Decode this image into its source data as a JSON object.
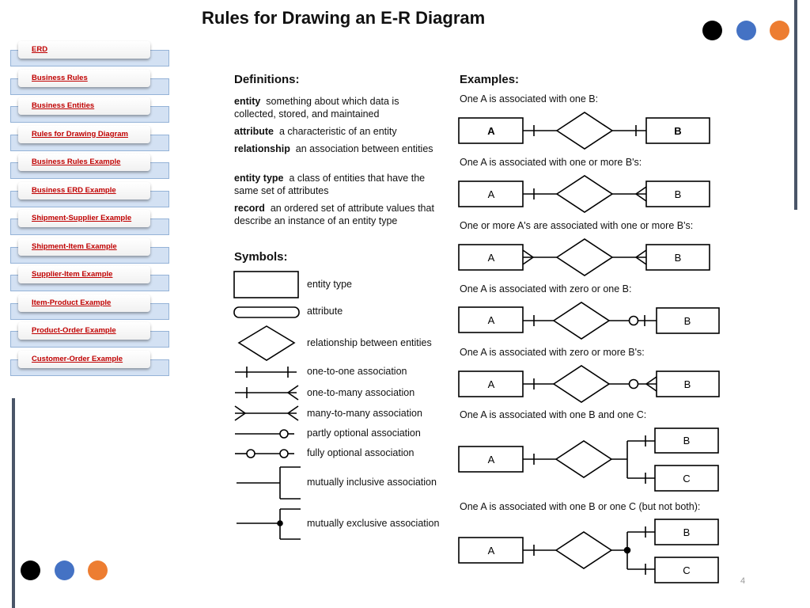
{
  "title": "Rules for Drawing an E-R Diagram",
  "page_number": "4",
  "colors": {
    "dot_black": "#000000",
    "dot_blue": "#4472c4",
    "dot_orange": "#ed7d31",
    "nav_link": "#c00000",
    "nav_back": "#d3e1f3",
    "accent_bar": "#4a5568"
  },
  "nav": {
    "items": [
      {
        "label": "ERD"
      },
      {
        "label": "Business Rules"
      },
      {
        "label": "Business Entities"
      },
      {
        "label": "Rules for Drawing Diagram"
      },
      {
        "label": "Business Rules Example"
      },
      {
        "label": "Business ERD Example"
      },
      {
        "label": "Shipment-Supplier Example"
      },
      {
        "label": "Shipment-Item Example"
      },
      {
        "label": "Supplier-Item Example"
      },
      {
        "label": "Item-Product Example"
      },
      {
        "label": "Product-Order Example"
      },
      {
        "label": "Customer-Order Example"
      }
    ]
  },
  "definitions": {
    "heading": "Definitions:",
    "items": [
      {
        "term": "entity",
        "text": "something about which data is collected, stored, and maintained"
      },
      {
        "term": "attribute",
        "text": "a characteristic of an entity"
      },
      {
        "term": "relationship",
        "text": "an association between entities"
      },
      {
        "term": "entity type",
        "text": "a class of entities that have the same set of attributes"
      },
      {
        "term": "record",
        "text": "an ordered set of attribute values that describe an instance of an entity type"
      }
    ]
  },
  "symbols": {
    "heading": "Symbols:",
    "items": [
      {
        "icon": "entity-type-rectangle",
        "label": "entity type"
      },
      {
        "icon": "attribute-rounded-rectangle",
        "label": "attribute"
      },
      {
        "icon": "relationship-diamond",
        "label": "relationship between entities"
      },
      {
        "icon": "one-to-one-line",
        "label": "one-to-one association"
      },
      {
        "icon": "one-to-many-line",
        "label": "one-to-many association"
      },
      {
        "icon": "many-to-many-line",
        "label": "many-to-many association"
      },
      {
        "icon": "partly-optional-line",
        "label": "partly optional association"
      },
      {
        "icon": "fully-optional-line",
        "label": "fully optional association"
      },
      {
        "icon": "mutually-inclusive-bracket",
        "label": "mutually inclusive association"
      },
      {
        "icon": "mutually-exclusive-bracket",
        "label": "mutually exclusive association"
      }
    ]
  },
  "examples": {
    "heading": "Examples:",
    "items": [
      {
        "caption": "One A is associated with one B:",
        "left": "A",
        "right": [
          "B"
        ]
      },
      {
        "caption": "One A is associated with one or more B's:",
        "left": "A",
        "right": [
          "B"
        ]
      },
      {
        "caption": "One or more A's are associated with one or more B's:",
        "left": "A",
        "right": [
          "B"
        ]
      },
      {
        "caption": "One A is associated with zero or one B:",
        "left": "A",
        "right": [
          "B"
        ]
      },
      {
        "caption": "One A is associated with zero or more B's:",
        "left": "A",
        "right": [
          "B"
        ]
      },
      {
        "caption": "One A is associated with one B and one C:",
        "left": "A",
        "right": [
          "B",
          "C"
        ]
      },
      {
        "caption": "One A is associated with one B or one C (but not both):",
        "left": "A",
        "right": [
          "B",
          "C"
        ]
      }
    ]
  }
}
